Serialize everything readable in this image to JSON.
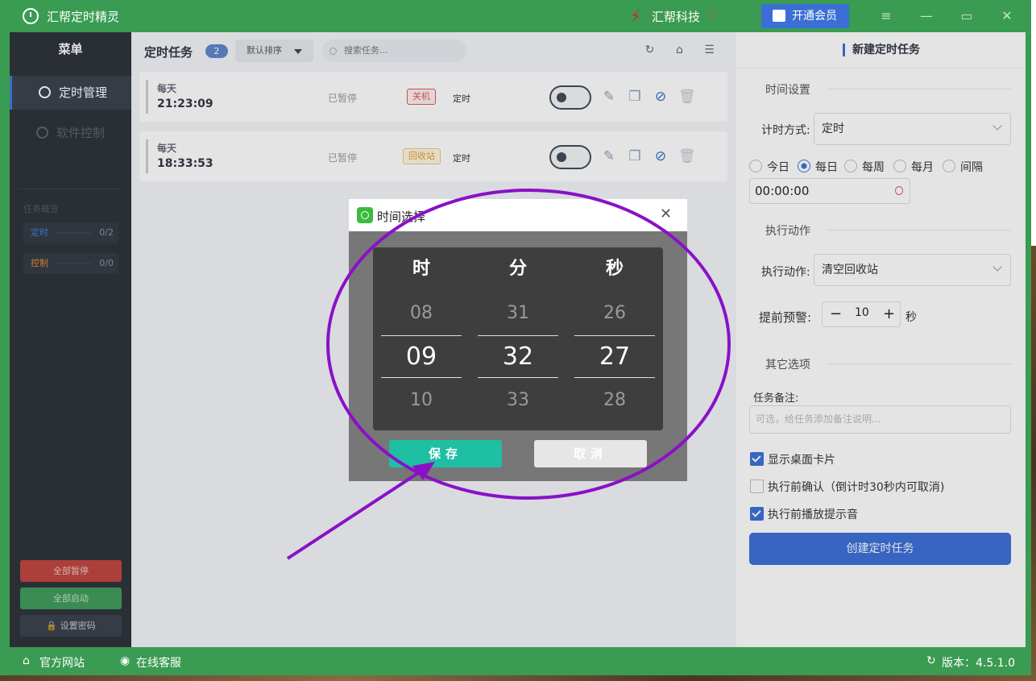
{
  "app": {
    "title": "汇帮定时精灵",
    "brand": "汇帮科技",
    "vip_label": "开通会员"
  },
  "sidebar": {
    "menu_title": "菜单",
    "items": [
      {
        "label": "定时管理"
      },
      {
        "label": "软件控制"
      }
    ],
    "overview_title": "任务概览",
    "overview": [
      {
        "label": "定时",
        "count": "0/2",
        "color": "#3b7ddd"
      },
      {
        "label": "控制",
        "count": "0/0",
        "color": "#e08a3a"
      }
    ],
    "buttons": [
      {
        "label": "全部暂停",
        "color": "#c0443c"
      },
      {
        "label": "全部启动",
        "color": "#3e9b58"
      },
      {
        "label": "设置密码",
        "color": "#3a4049"
      }
    ]
  },
  "tasks": {
    "title": "定时任务",
    "count": "2",
    "sort_label": "默认排序",
    "search_placeholder": "搜索任务...",
    "list": [
      {
        "freq": "每天",
        "time": "21:23:09",
        "status": "已暂停",
        "action": "关机",
        "type": "定时"
      },
      {
        "freq": "每天",
        "time": "18:33:53",
        "status": "已暂停",
        "action": "回收站",
        "type": "定时"
      }
    ]
  },
  "form": {
    "title": "新建定时任务",
    "time_section": "时间设置",
    "timing_mode_label": "计时方式:",
    "timing_mode_value": "定时",
    "radios": [
      "今日",
      "每日",
      "每周",
      "每月",
      "间隔"
    ],
    "selected_radio": "每日",
    "time_value": "00:00:00",
    "action_section": "执行动作",
    "action_label": "执行动作:",
    "action_value": "清空回收站",
    "warn_label": "提前预警:",
    "warn_value": "10",
    "warn_unit": "秒",
    "other_section": "其它选项",
    "remark_label": "任务备注:",
    "remark_placeholder": "可选，给任务添加备注说明...",
    "checks": [
      {
        "label": "显示桌面卡片",
        "checked": true
      },
      {
        "label": "执行前确认（倒计时30秒内可取消)",
        "checked": false
      },
      {
        "label": "执行前播放提示音",
        "checked": true
      }
    ],
    "create_label": "创建定时任务"
  },
  "footer": {
    "website": "官方网站",
    "support": "在线客服",
    "version": "版本：4.5.1.0"
  },
  "dialog": {
    "title": "时间选择",
    "columns": [
      {
        "header": "时",
        "prev": "08",
        "current": "09",
        "next": "10"
      },
      {
        "header": "分",
        "prev": "31",
        "current": "32",
        "next": "33"
      },
      {
        "header": "秒",
        "prev": "26",
        "current": "27",
        "next": "28"
      }
    ],
    "save_label": "保存",
    "cancel_label": "取消"
  },
  "colors": {
    "primary_green": "#3a9b52",
    "primary_blue": "#3b6fd6",
    "save_teal": "#1fbfa3",
    "annotation_purple": "#8a10c8"
  }
}
